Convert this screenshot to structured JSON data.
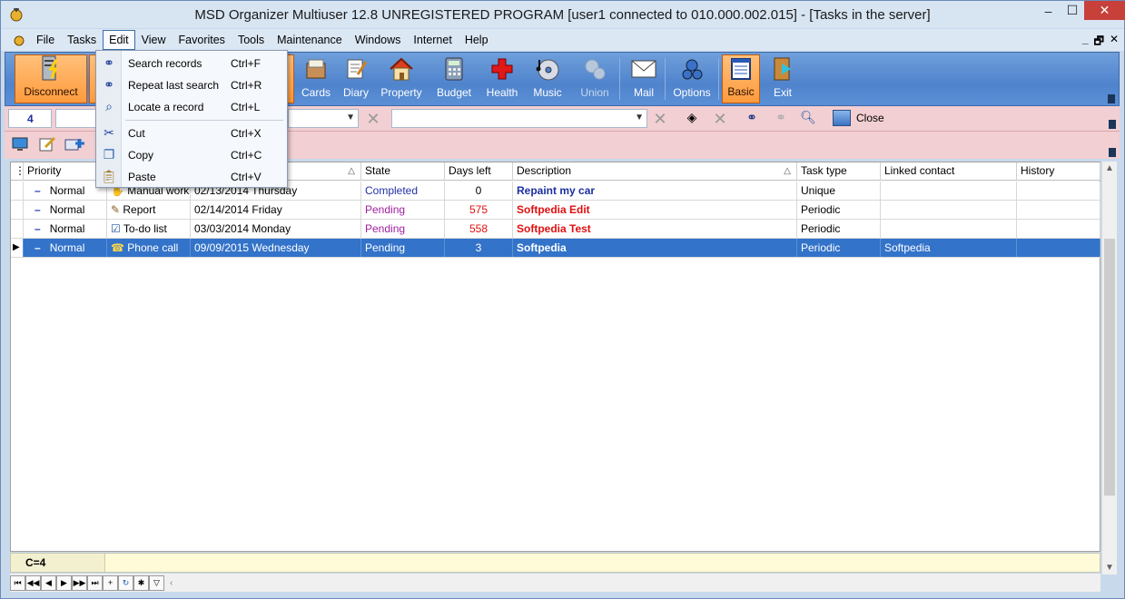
{
  "window": {
    "title": "MSD Organizer Multiuser 12.8 UNREGISTERED PROGRAM [user1 connected to 010.000.002.015] - [Tasks in the server]",
    "min": "–",
    "max": "☐",
    "close": "✕"
  },
  "menubar": {
    "items": [
      "File",
      "Tasks",
      "Edit",
      "View",
      "Favorites",
      "Tools",
      "Maintenance",
      "Windows",
      "Internet",
      "Help"
    ],
    "active": "Edit",
    "mdi": [
      "_",
      "🗗",
      "✕"
    ]
  },
  "toolbar": {
    "disconnect": "Disconnect",
    "cards": "Cards",
    "diary": "Diary",
    "property": "Property",
    "budget": "Budget",
    "health": "Health",
    "music": "Music",
    "union": "Union",
    "mail": "Mail",
    "options": "Options",
    "basic": "Basic",
    "exit": "Exit"
  },
  "search": {
    "count_value": "4",
    "close_label": "Close"
  },
  "edit_menu": [
    {
      "label": "Search records",
      "shortcut": "Ctrl+F"
    },
    {
      "label": "Repeat last search",
      "shortcut": "Ctrl+R"
    },
    {
      "label": "Locate a record",
      "shortcut": "Ctrl+L"
    },
    {
      "label": "Cut",
      "shortcut": "Ctrl+X"
    },
    {
      "label": "Copy",
      "shortcut": "Ctrl+C"
    },
    {
      "label": "Paste",
      "shortcut": "Ctrl+V"
    }
  ],
  "grid": {
    "headers": {
      "priority": "Priority",
      "state": "State",
      "days_left": "Days left",
      "description": "Description",
      "task_type": "Task type",
      "linked_contact": "Linked contact",
      "history": "History"
    },
    "rows": [
      {
        "priority": "Normal",
        "type": "Manual work",
        "date": "02/13/2014 Thursday",
        "state": "Completed",
        "days": "0",
        "description": "Repaint my car",
        "task_type": "Unique",
        "contact": ""
      },
      {
        "priority": "Normal",
        "type": "Report",
        "date": "02/14/2014 Friday",
        "state": "Pending",
        "days": "575",
        "description": "Softpedia Edit",
        "task_type": "Periodic",
        "contact": ""
      },
      {
        "priority": "Normal",
        "type": "To-do list",
        "date": "03/03/2014 Monday",
        "state": "Pending",
        "days": "558",
        "description": "Softpedia Test",
        "task_type": "Periodic",
        "contact": ""
      },
      {
        "priority": "Normal",
        "type": "Phone call",
        "date": "09/09/2015 Wednesday",
        "state": "Pending",
        "days": "3",
        "description": "Softpedia",
        "task_type": "Periodic",
        "contact": "Softpedia"
      }
    ]
  },
  "footer": {
    "count": "C=4"
  },
  "colors": {
    "toolbar_blue": "#4f83cc",
    "search_pink": "#f2cfd2",
    "selected_row": "#3373c9",
    "pending": "#a020a0",
    "completed": "#2030a8",
    "days_red": "#e01010"
  }
}
